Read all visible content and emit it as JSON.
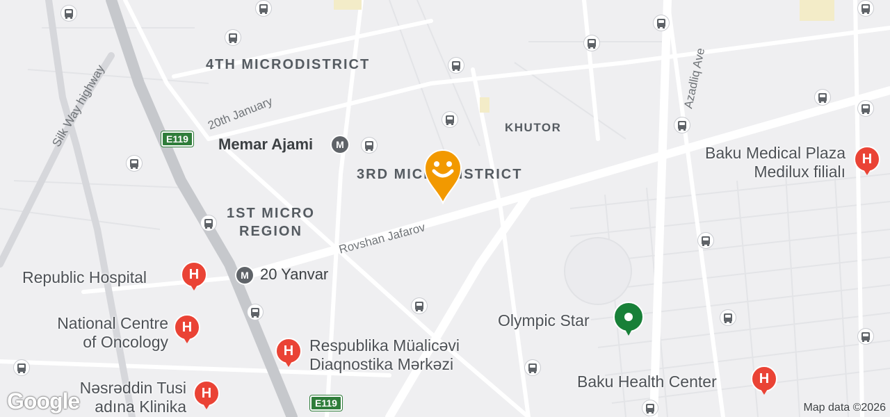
{
  "districts": {
    "fourth": "4TH MICRODISTRICT",
    "khutor": "KHUTOR",
    "third": "3RD MICRODISTRICT",
    "first_line1": "1ST MICRO",
    "first_line2": "REGION"
  },
  "roads": {
    "silk_way": "Silk Way highway",
    "jan20": "20th January",
    "rovshan": "Rovshan Jafarov",
    "azadliq": "Azadliq Ave"
  },
  "shields": {
    "top": "E119",
    "bottom": "E119"
  },
  "metro": {
    "memar": "Memar Ajami",
    "yanvar": "20 Yanvar",
    "glyph": "M"
  },
  "pois": {
    "republic_hospital": "Republic Hospital",
    "oncology_line1": "National Centre",
    "oncology_line2": "of Oncology",
    "respublika_line1": "Respublika Müalicəvi",
    "respublika_line2": "Diaqnostika Mərkəzi",
    "tusi_line1": "Nəsrəddin Tusi",
    "tusi_line2": "adına Klinika",
    "medical_plaza_line1": "Baku Medical Plaza",
    "medical_plaza_line2": "Medilux filialı",
    "olympic_star": "Olympic Star",
    "health_center": "Baku Health Center"
  },
  "hospital_glyph": "H",
  "icons": {
    "bus": "bus-stop-icon",
    "metro": "metro-icon",
    "hospital": "hospital-icon",
    "smile": "current-location-smile-icon",
    "place": "place-icon"
  },
  "colors": {
    "hospital": "#ea4335",
    "highway_shield": "#2f7d3a",
    "place_pin": "#188038",
    "marker": "#f29900"
  },
  "attribution": "Map data ©2026",
  "logo": "Google"
}
